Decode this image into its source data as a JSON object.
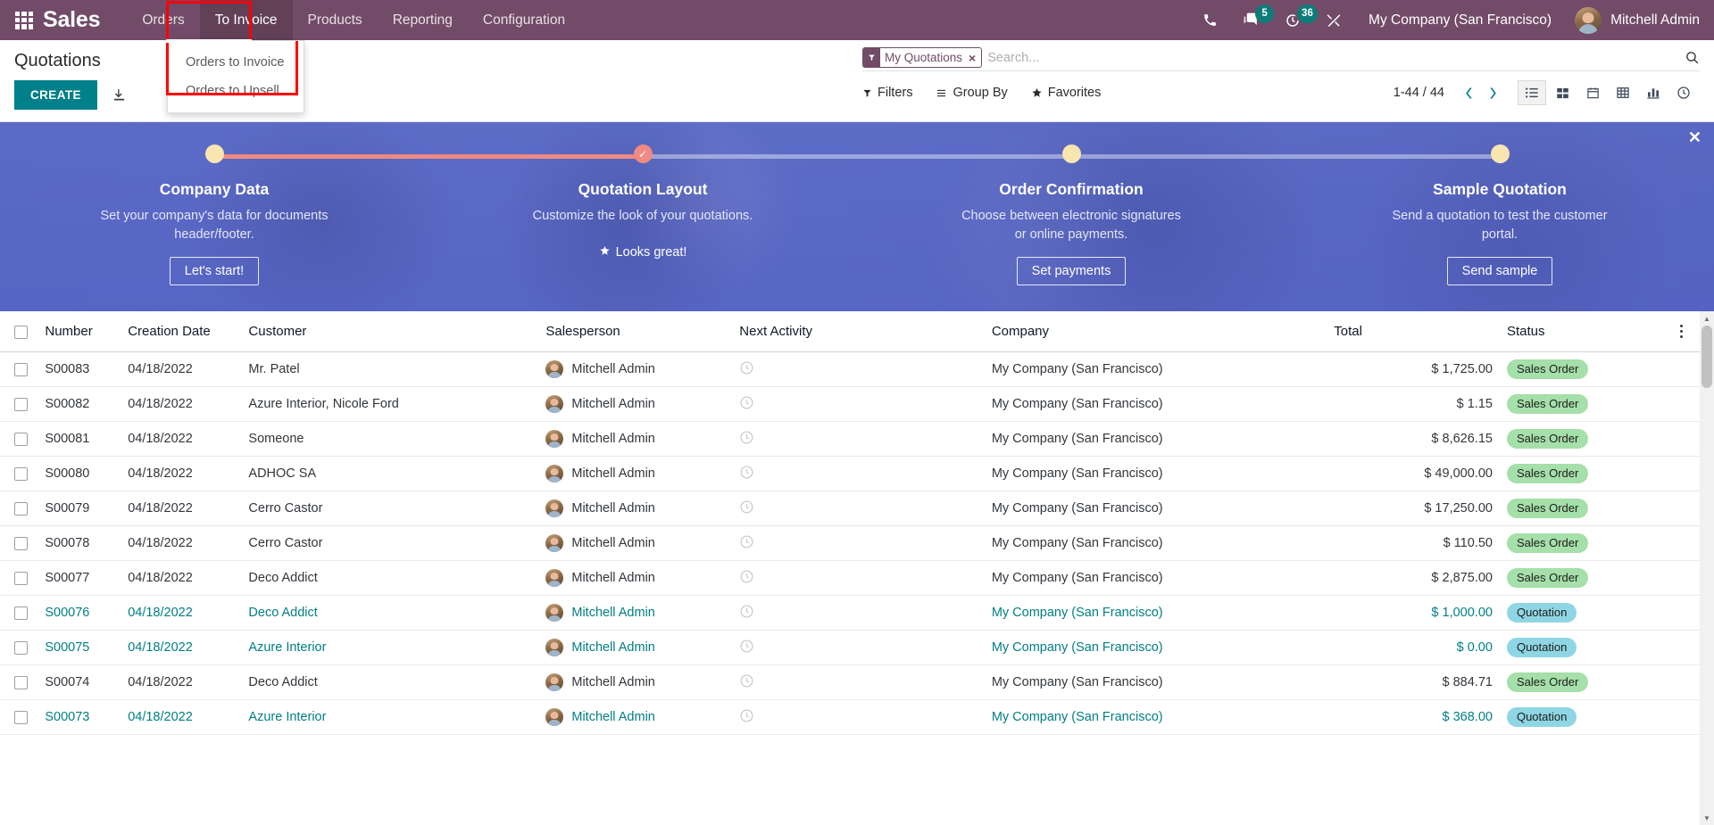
{
  "navbar": {
    "apps_icon": "apps-grid-icon",
    "brand": "Sales",
    "menus": [
      {
        "label": "Orders",
        "active": false
      },
      {
        "label": "To Invoice",
        "active": true
      },
      {
        "label": "Products",
        "active": false
      },
      {
        "label": "Reporting",
        "active": false
      },
      {
        "label": "Configuration",
        "active": false
      }
    ],
    "dropdown": {
      "items": [
        {
          "label": "Orders to Invoice"
        },
        {
          "label": "Orders to Upsell"
        }
      ]
    },
    "icons": {
      "phone": "phone-icon",
      "messages": "chat-icon",
      "messages_count": "5",
      "activities": "clock-activity-icon",
      "activities_count": "36",
      "debug": "wrench-tools-icon"
    },
    "company": "My Company (San Francisco)",
    "user": "Mitchell Admin",
    "accent": "#714B67"
  },
  "control_panel": {
    "breadcrumb": "Quotations",
    "create_label": "CREATE",
    "create_color": "#00808a",
    "import_icon": "import-download-icon",
    "search": {
      "facet_label": "My Quotations",
      "facet_icon": "filter-funnel-icon",
      "facet_close": "×",
      "placeholder": "Search...",
      "value": "",
      "search_icon": "search-icon"
    },
    "filters": [
      {
        "label": "Filters",
        "icon": "filter-funnel-icon"
      },
      {
        "label": "Group By",
        "icon": "hamburger-lines-icon"
      },
      {
        "label": "Favorites",
        "icon": "star-icon"
      }
    ],
    "pager": "1-44 / 44",
    "prev_icon": "chevron-left-icon",
    "next_icon": "chevron-right-icon",
    "views": [
      {
        "name": "list-view",
        "icon": "list-icon",
        "active": true
      },
      {
        "name": "kanban-view",
        "icon": "kanban-icon",
        "active": false
      },
      {
        "name": "calendar-view",
        "icon": "calendar-icon",
        "active": false
      },
      {
        "name": "pivot-view",
        "icon": "pivot-table-icon",
        "active": false
      },
      {
        "name": "graph-view",
        "icon": "bar-chart-icon",
        "active": false
      },
      {
        "name": "activity-view",
        "icon": "clock-icon",
        "active": false
      }
    ]
  },
  "banner": {
    "close_icon": "close-icon",
    "steps": [
      {
        "title": "Company Data",
        "desc": "Set your company's data for documents header/footer.",
        "action": "Let's start!",
        "state": "current",
        "dot": "plain"
      },
      {
        "title": "Quotation Layout",
        "desc": "Customize the look of your quotations.",
        "action": "Looks great!",
        "state": "done",
        "dot": "check"
      },
      {
        "title": "Order Confirmation",
        "desc": "Choose between electronic signatures or online payments.",
        "action": "Set payments",
        "state": "todo",
        "dot": "plain"
      },
      {
        "title": "Sample Quotation",
        "desc": "Send a quotation to test the customer portal.",
        "action": "Send sample",
        "state": "todo",
        "dot": "plain"
      }
    ]
  },
  "table": {
    "columns": [
      "Number",
      "Creation Date",
      "Customer",
      "Salesperson",
      "Next Activity",
      "Company",
      "Total",
      "Status"
    ],
    "optional_icon": "column-options-icon",
    "rows": [
      {
        "number": "S00083",
        "date": "04/18/2022",
        "customer": "Mr. Patel",
        "salesperson": "Mitchell Admin",
        "activity": "",
        "company": "My Company (San Francisco)",
        "total": "$ 1,725.00",
        "status": "Sales Order",
        "state": "sale"
      },
      {
        "number": "S00082",
        "date": "04/18/2022",
        "customer": "Azure Interior, Nicole Ford",
        "salesperson": "Mitchell Admin",
        "activity": "",
        "company": "My Company (San Francisco)",
        "total": "$ 1.15",
        "status": "Sales Order",
        "state": "sale"
      },
      {
        "number": "S00081",
        "date": "04/18/2022",
        "customer": "Someone",
        "salesperson": "Mitchell Admin",
        "activity": "",
        "company": "My Company (San Francisco)",
        "total": "$ 8,626.15",
        "status": "Sales Order",
        "state": "sale"
      },
      {
        "number": "S00080",
        "date": "04/18/2022",
        "customer": "ADHOC SA",
        "salesperson": "Mitchell Admin",
        "activity": "",
        "company": "My Company (San Francisco)",
        "total": "$ 49,000.00",
        "status": "Sales Order",
        "state": "sale"
      },
      {
        "number": "S00079",
        "date": "04/18/2022",
        "customer": "Cerro Castor",
        "salesperson": "Mitchell Admin",
        "activity": "",
        "company": "My Company (San Francisco)",
        "total": "$ 17,250.00",
        "status": "Sales Order",
        "state": "sale"
      },
      {
        "number": "S00078",
        "date": "04/18/2022",
        "customer": "Cerro Castor",
        "salesperson": "Mitchell Admin",
        "activity": "",
        "company": "My Company (San Francisco)",
        "total": "$ 110.50",
        "status": "Sales Order",
        "state": "sale"
      },
      {
        "number": "S00077",
        "date": "04/18/2022",
        "customer": "Deco Addict",
        "salesperson": "Mitchell Admin",
        "activity": "",
        "company": "My Company (San Francisco)",
        "total": "$ 2,875.00",
        "status": "Sales Order",
        "state": "sale"
      },
      {
        "number": "S00076",
        "date": "04/18/2022",
        "customer": "Deco Addict",
        "salesperson": "Mitchell Admin",
        "activity": "",
        "company": "My Company (San Francisco)",
        "total": "$ 1,000.00",
        "status": "Quotation",
        "state": "quotation"
      },
      {
        "number": "S00075",
        "date": "04/18/2022",
        "customer": "Azure Interior",
        "salesperson": "Mitchell Admin",
        "activity": "",
        "company": "My Company (San Francisco)",
        "total": "$ 0.00",
        "status": "Quotation",
        "state": "quotation"
      },
      {
        "number": "S00074",
        "date": "04/18/2022",
        "customer": "Deco Addict",
        "salesperson": "Mitchell Admin",
        "activity": "",
        "company": "My Company (San Francisco)",
        "total": "$ 884.71",
        "status": "Sales Order",
        "state": "sale"
      },
      {
        "number": "S00073",
        "date": "04/18/2022",
        "customer": "Azure Interior",
        "salesperson": "Mitchell Admin",
        "activity": "",
        "company": "My Company (San Francisco)",
        "total": "$ 368.00",
        "status": "Quotation",
        "state": "quotation"
      }
    ]
  }
}
